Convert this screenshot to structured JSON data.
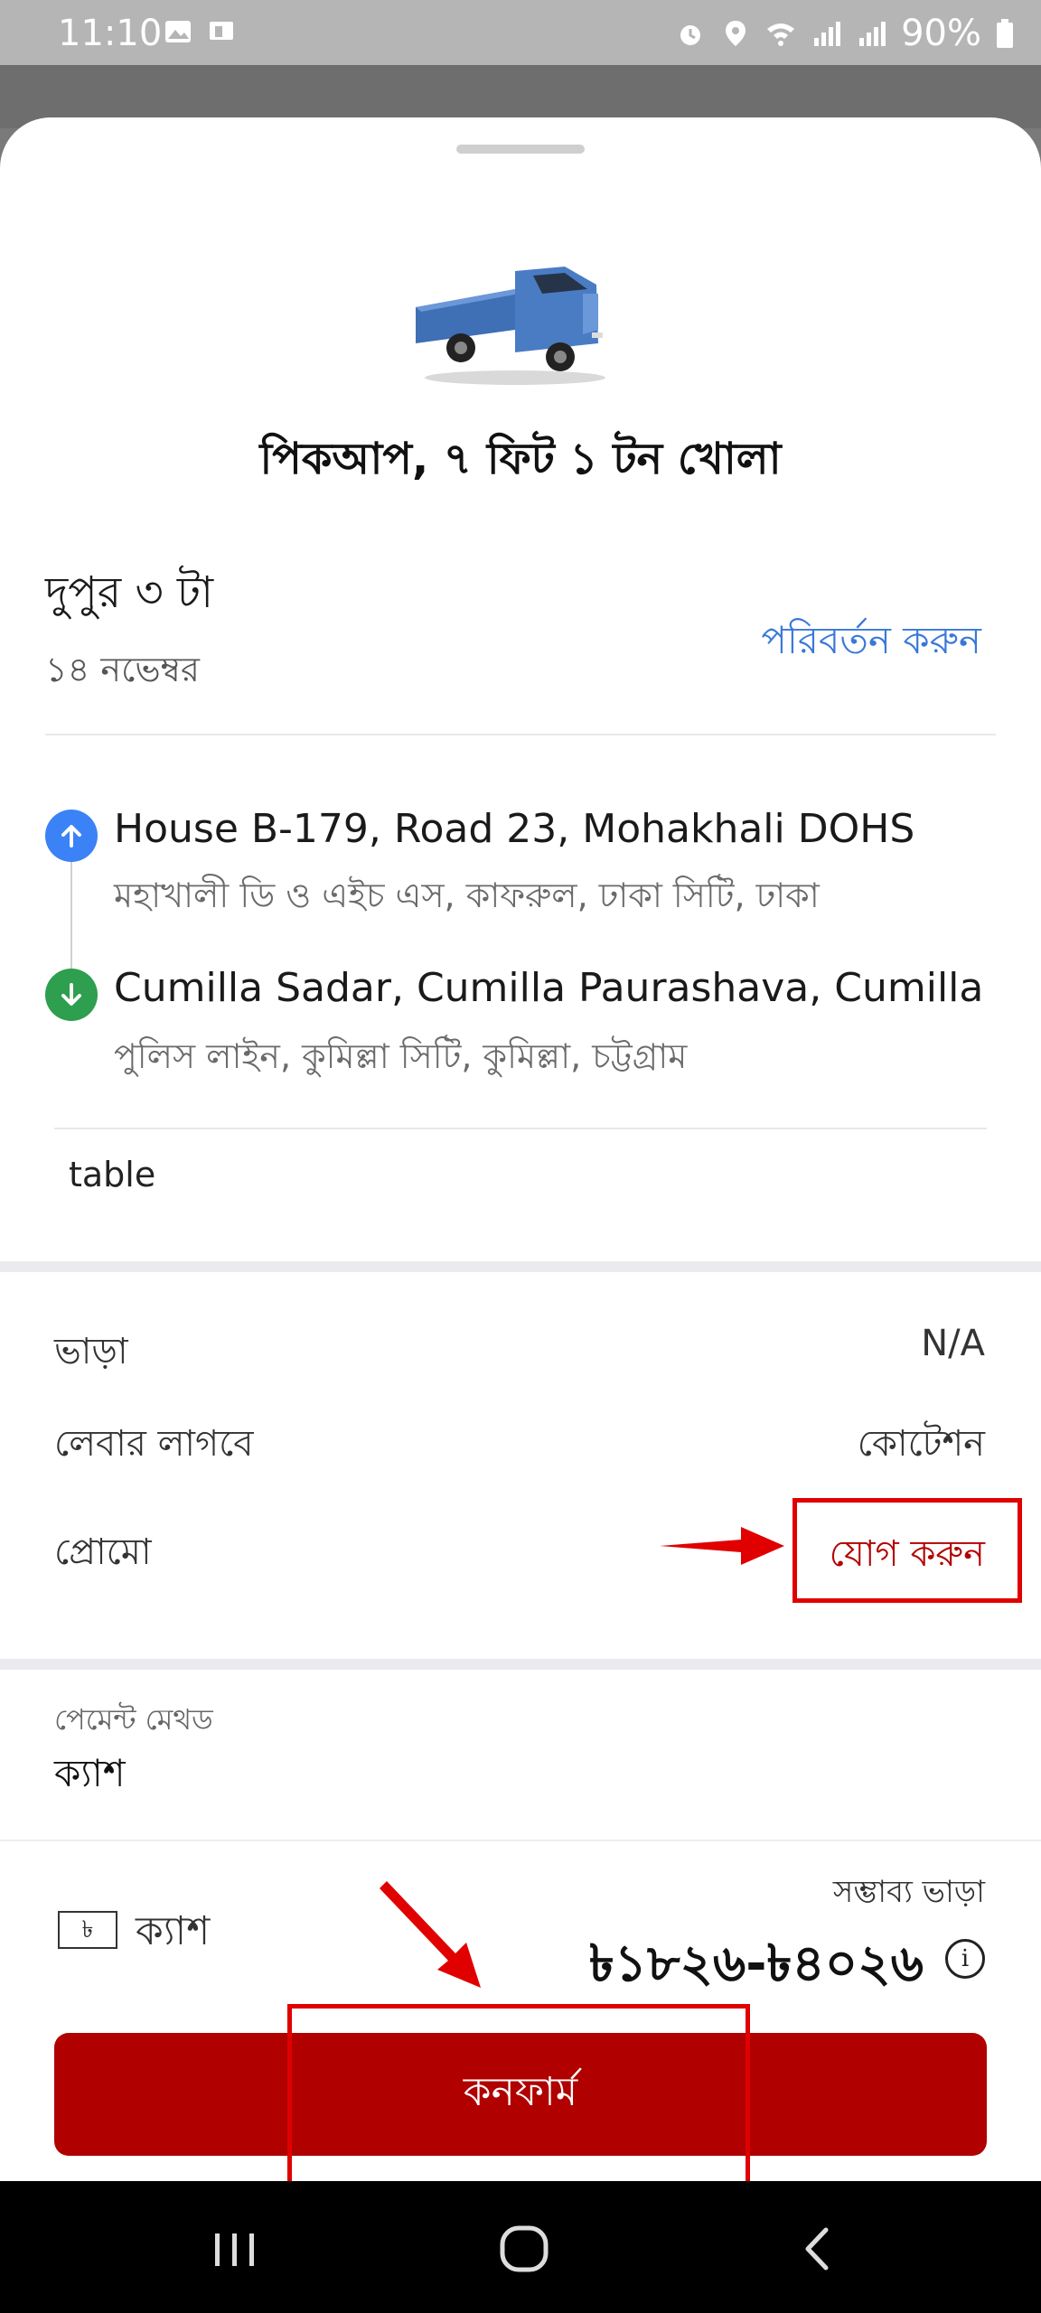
{
  "status_bar": {
    "time": "11:10",
    "battery": "90%"
  },
  "vehicle": {
    "title": "পিকআপ, ৭ ফিট ১ টন খোলা"
  },
  "schedule": {
    "time": "দুপুর ৩ টা",
    "date": "১৪ নভেম্বর",
    "change_label": "পরিবর্তন করুন"
  },
  "route": {
    "pickup": {
      "main": "House B-179, Road 23, Mohakhali DOHS",
      "sub": "মহাখালী ডি ও এইচ এস, কাফরুল, ঢাকা সিটি, ঢাকা"
    },
    "dropoff": {
      "main": "Cumilla Sadar, Cumilla Paurashava, Cumilla",
      "sub": "পুলিস লাইন, কুমিল্লা সিটি, কুমিল্লা, চট্টগ্রাম"
    },
    "note": "table"
  },
  "charges": {
    "fare_label": "ভাড়া",
    "fare_value": "N/A",
    "labour_label": "লেবার লাগবে",
    "labour_value": "কোটেশন",
    "promo_label": "প্রোমো",
    "promo_action": "যোগ করুন"
  },
  "payment": {
    "caption": "পেমেন্ট মেথড",
    "method": "ক্যাশ"
  },
  "footer": {
    "cash_icon_text": "৳",
    "cash_label": "ক্যাশ",
    "estimate_caption": "সম্ভাব্য ভাড়া",
    "estimate_value": "৳১৮২৬-৳৪০২৬",
    "info_icon_text": "i",
    "confirm_label": "কনফার্ম"
  },
  "colors": {
    "primary": "#b00000",
    "link": "#3a78d8",
    "pickup_dot": "#3b82f6",
    "dropoff_dot": "#2e9e4f",
    "annotation": "#e00000"
  }
}
